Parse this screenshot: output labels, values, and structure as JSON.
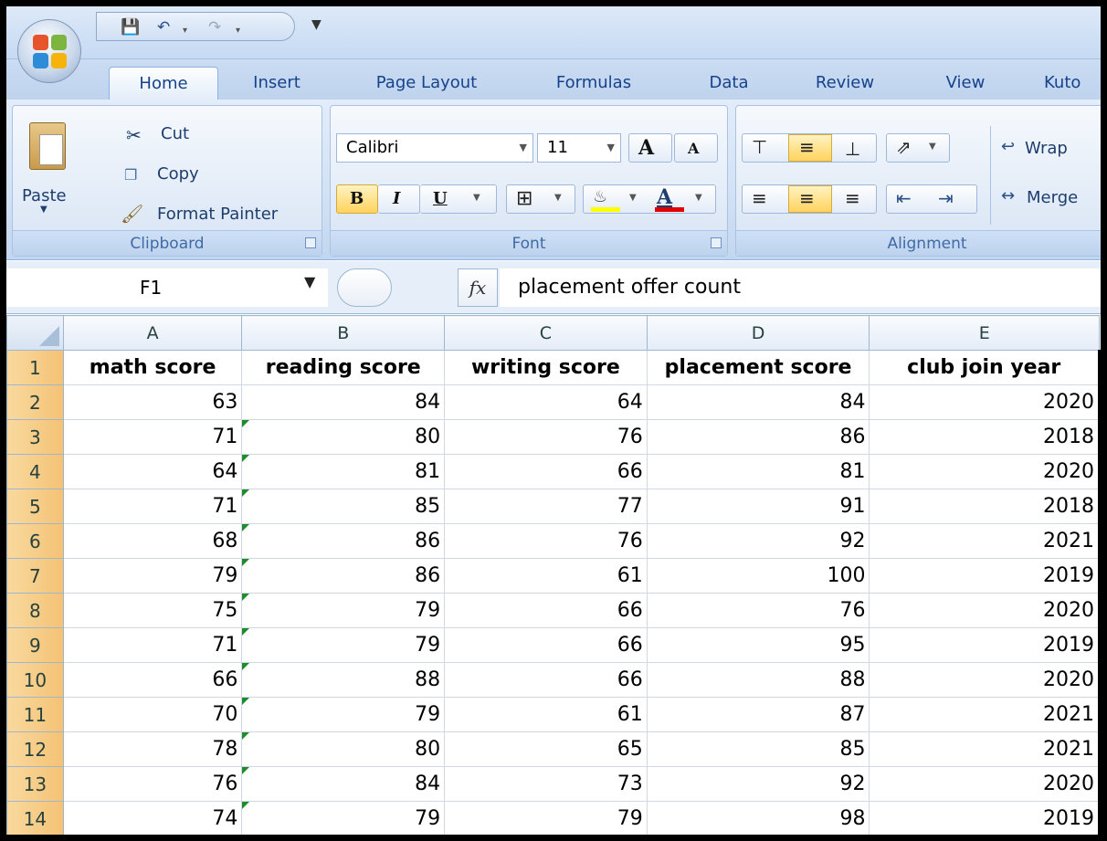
{
  "quick_access": {
    "save_icon": "save-icon",
    "undo_icon": "undo-icon",
    "redo_icon": "redo-icon",
    "customize_icon": "customize-qat-icon"
  },
  "tabs": [
    "Home",
    "Insert",
    "Page Layout",
    "Formulas",
    "Data",
    "Review",
    "View",
    "Kuto"
  ],
  "active_tab": "Home",
  "clipboard": {
    "group_label": "Clipboard",
    "paste": "Paste",
    "cut": "Cut",
    "copy": "Copy",
    "format_painter": "Format Painter"
  },
  "font": {
    "group_label": "Font",
    "font_name": "Calibri",
    "font_size": "11",
    "bold": "B",
    "italic": "I",
    "underline": "U",
    "grow": "A",
    "shrink": "A",
    "font_color_letter": "A",
    "fill_color": "#ffff00",
    "font_color": "#e00000"
  },
  "alignment": {
    "group_label": "Alignment",
    "wrap": "Wrap",
    "merge": "Merge"
  },
  "formula_bar": {
    "name_box": "F1",
    "fx": "fx",
    "content": "placement offer count"
  },
  "sheet": {
    "columns": [
      "A",
      "B",
      "C",
      "D",
      "E"
    ],
    "rows": [
      {
        "n": "1",
        "cells": [
          "math score",
          "reading score",
          "writing score",
          "placement score",
          "club join year"
        ]
      },
      {
        "n": "2",
        "cells": [
          "63",
          "84",
          "64",
          "84",
          "2020"
        ]
      },
      {
        "n": "3",
        "cells": [
          "71",
          "80",
          "76",
          "86",
          "2018"
        ]
      },
      {
        "n": "4",
        "cells": [
          "64",
          "81",
          "66",
          "81",
          "2020"
        ]
      },
      {
        "n": "5",
        "cells": [
          "71",
          "85",
          "77",
          "91",
          "2018"
        ]
      },
      {
        "n": "6",
        "cells": [
          "68",
          "86",
          "76",
          "92",
          "2021"
        ]
      },
      {
        "n": "7",
        "cells": [
          "79",
          "86",
          "61",
          "100",
          "2019"
        ]
      },
      {
        "n": "8",
        "cells": [
          "75",
          "79",
          "66",
          "76",
          "2020"
        ]
      },
      {
        "n": "9",
        "cells": [
          "71",
          "79",
          "66",
          "95",
          "2019"
        ]
      },
      {
        "n": "10",
        "cells": [
          "66",
          "88",
          "66",
          "88",
          "2020"
        ]
      },
      {
        "n": "11",
        "cells": [
          "70",
          "79",
          "61",
          "87",
          "2021"
        ]
      },
      {
        "n": "12",
        "cells": [
          "78",
          "80",
          "65",
          "85",
          "2021"
        ]
      },
      {
        "n": "13",
        "cells": [
          "76",
          "84",
          "73",
          "92",
          "2020"
        ]
      },
      {
        "n": "14",
        "cells": [
          "74",
          "79",
          "79",
          "98",
          "2019"
        ]
      }
    ]
  }
}
